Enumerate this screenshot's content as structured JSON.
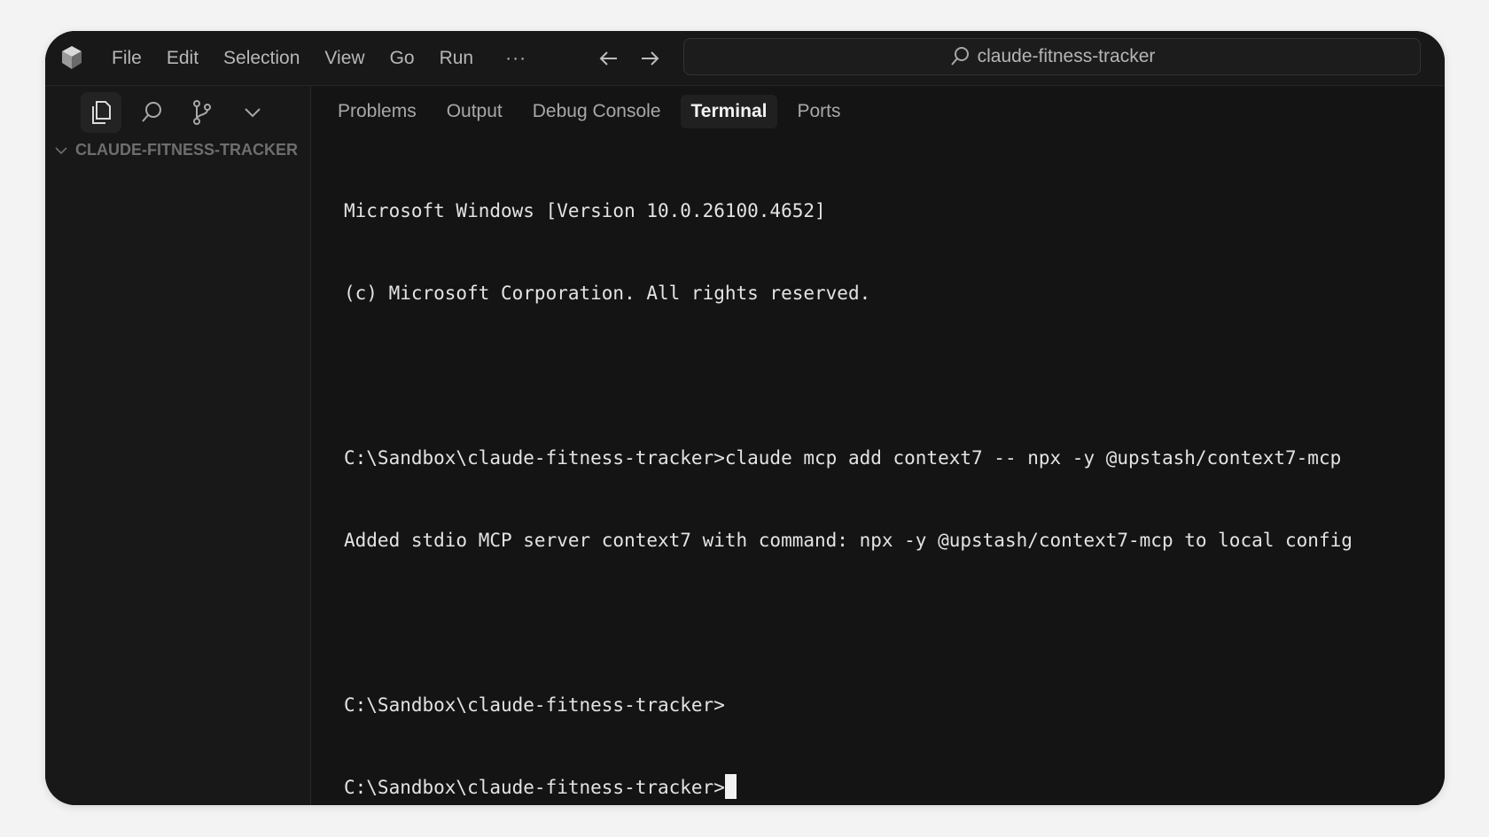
{
  "window": {
    "search_text": "claude-fitness-tracker"
  },
  "menu": {
    "items": [
      {
        "label": "File"
      },
      {
        "label": "Edit"
      },
      {
        "label": "Selection"
      },
      {
        "label": "View"
      },
      {
        "label": "Go"
      },
      {
        "label": "Run"
      }
    ],
    "more_label": "···"
  },
  "sidebar": {
    "explorer_title": "CLAUDE-FITNESS-TRACKER",
    "activity_icons": [
      "files-icon",
      "search-icon",
      "source-control-icon",
      "chevron-down-icon"
    ]
  },
  "panel": {
    "tabs": [
      {
        "label": "Problems",
        "active": false
      },
      {
        "label": "Output",
        "active": false
      },
      {
        "label": "Debug Console",
        "active": false
      },
      {
        "label": "Terminal",
        "active": true
      },
      {
        "label": "Ports",
        "active": false
      }
    ]
  },
  "terminal": {
    "lines": [
      "Microsoft Windows [Version 10.0.26100.4652]",
      "(c) Microsoft Corporation. All rights reserved.",
      "",
      "C:\\Sandbox\\claude-fitness-tracker>claude mcp add context7 -- npx -y @upstash/context7-mcp",
      "Added stdio MCP server context7 with command: npx -y @upstash/context7-mcp to local config",
      "",
      "C:\\Sandbox\\claude-fitness-tracker>",
      "C:\\Sandbox\\claude-fitness-tracker>"
    ]
  },
  "colors": {
    "window_bg": "#141414",
    "chrome_bg": "#181818",
    "text": "#e3e3e3",
    "muted_text": "#b7b7b7"
  }
}
